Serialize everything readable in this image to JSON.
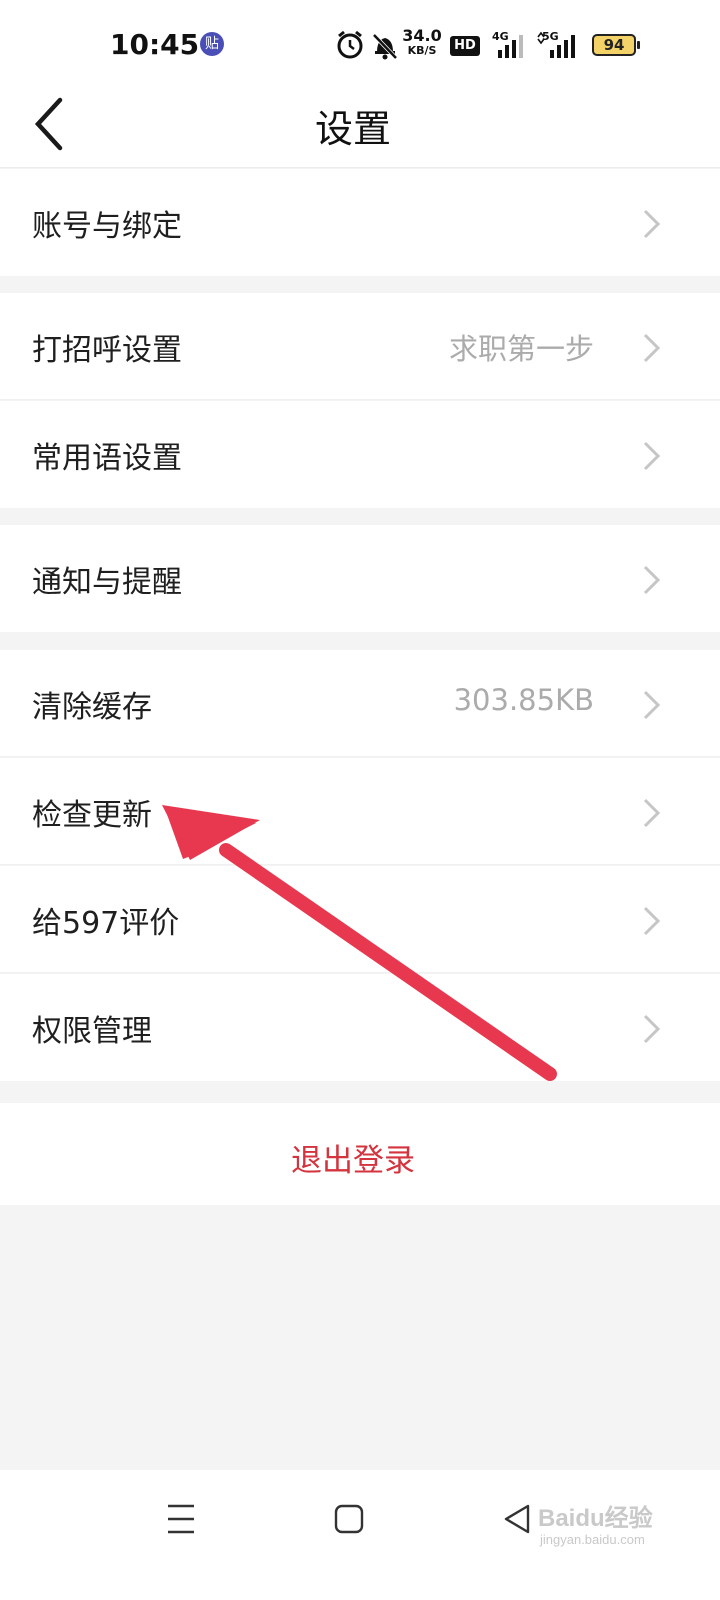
{
  "status_bar": {
    "time": "10:45",
    "app_badge": "贴",
    "speed_value": "34.0",
    "speed_unit": "KB/S",
    "hd_label": "HD",
    "signal_4g": "4G",
    "signal_5g": "5G",
    "battery": "94",
    "icons": [
      "alarm-icon",
      "mute-bell-icon",
      "hd-voice-icon",
      "signal-4g-icon",
      "signal-5g-icon",
      "battery-icon"
    ]
  },
  "header": {
    "title": "设置",
    "back_icon": "chevron-left-icon"
  },
  "settings": {
    "groups": [
      [
        {
          "label": "账号与绑定"
        }
      ],
      [
        {
          "label": "打招呼设置",
          "value": "求职第一步"
        },
        {
          "label": "常用语设置"
        }
      ],
      [
        {
          "label": "通知与提醒"
        }
      ],
      [
        {
          "label": "清除缓存",
          "value": "303.85KB"
        },
        {
          "label": "检查更新"
        },
        {
          "label": "给597评价"
        },
        {
          "label": "权限管理"
        }
      ]
    ]
  },
  "logout": {
    "label": "退出登录"
  },
  "annotation": {
    "arrow_color": "#e8384f",
    "target": "检查更新"
  },
  "nav_bar": {
    "icons": [
      "menu-icon",
      "home-square-icon",
      "back-triangle-icon"
    ],
    "watermark": "Baidu经验",
    "watermark_sub": "jingyan.baidu.com"
  },
  "colors": {
    "background": "#f4f4f4",
    "logout_text": "#d4343e",
    "secondary_text": "#ababab"
  }
}
